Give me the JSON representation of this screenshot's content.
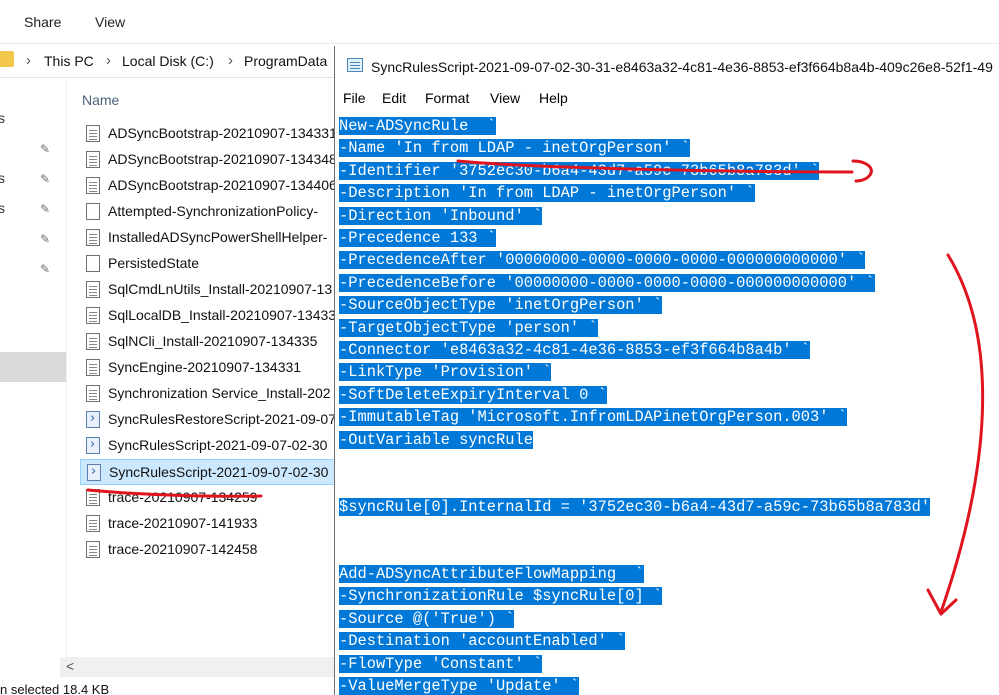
{
  "explorer": {
    "ribbon_tabs": [
      "Share",
      "View"
    ],
    "breadcrumb": [
      "This PC",
      "Local Disk (C:)",
      "ProgramData"
    ],
    "column_header": "Name",
    "nav_fragments": [
      "s",
      "s",
      "s"
    ],
    "files": [
      {
        "name": "ADSyncBootstrap-20210907-134331",
        "type": "text"
      },
      {
        "name": "ADSyncBootstrap-20210907-134348",
        "type": "text"
      },
      {
        "name": "ADSyncBootstrap-20210907-134406",
        "type": "text"
      },
      {
        "name": "Attempted-SynchronizationPolicy-",
        "type": "plain"
      },
      {
        "name": "InstalledADSyncPowerShellHelper-",
        "type": "text"
      },
      {
        "name": "PersistedState",
        "type": "plain"
      },
      {
        "name": "SqlCmdLnUtils_Install-20210907-13",
        "type": "text"
      },
      {
        "name": "SqlLocalDB_Install-20210907-13433",
        "type": "text"
      },
      {
        "name": "SqlNCli_Install-20210907-134335",
        "type": "text"
      },
      {
        "name": "SyncEngine-20210907-134331",
        "type": "text"
      },
      {
        "name": "Synchronization Service_Install-202",
        "type": "text"
      },
      {
        "name": "SyncRulesRestoreScript-2021-09-07",
        "type": "ps"
      },
      {
        "name": "SyncRulesScript-2021-09-07-02-30",
        "type": "ps"
      },
      {
        "name": "SyncRulesScript-2021-09-07-02-30",
        "type": "ps",
        "selected": true
      },
      {
        "name": "trace-20210907-134259",
        "type": "text"
      },
      {
        "name": "trace-20210907-141933",
        "type": "text"
      },
      {
        "name": "trace-20210907-142458",
        "type": "text"
      }
    ],
    "status": "n selected  18.4 KB"
  },
  "notepad": {
    "title": "SyncRulesScript-2021-09-07-02-30-31-e8463a32-4c81-4e36-8853-ef3f664b8a4b-409c26e8-52f1-49",
    "menu": [
      "File",
      "Edit",
      "Format",
      "View",
      "Help"
    ],
    "lines": [
      "New-ADSyncRule  `",
      "-Name 'In from LDAP - inetOrgPerson' `",
      "-Identifier '3752ec30-b6a4-43d7-a59c-73b65b8a783d' `",
      "-Description 'In from LDAP - inetOrgPerson' `",
      "-Direction 'Inbound' `",
      "-Precedence 133 `",
      "-PrecedenceAfter '00000000-0000-0000-0000-000000000000' `",
      "-PrecedenceBefore '00000000-0000-0000-0000-000000000000' `",
      "-SourceObjectType 'inetOrgPerson' `",
      "-TargetObjectType 'person' `",
      "-Connector 'e8463a32-4c81-4e36-8853-ef3f664b8a4b' `",
      "-LinkType 'Provision' `",
      "-SoftDeleteExpiryInterval 0 `",
      "-ImmutableTag 'Microsoft.InfromLDAPinetOrgPerson.003' `",
      "-OutVariable syncRule",
      "",
      "",
      "$syncRule[0].InternalId = '3752ec30-b6a4-43d7-a59c-73b65b8a783d'",
      "",
      "",
      "Add-ADSyncAttributeFlowMapping  `",
      "-SynchronizationRule $syncRule[0] `",
      "-Source @('True') `",
      "-Destination 'accountEnabled' `",
      "-FlowType 'Constant' `",
      "-ValueMergeType 'Update' `"
    ]
  },
  "colors": {
    "selection": "#0078d7",
    "annotation": "#e0141e",
    "explorer_selected_row": "#cce8ff"
  }
}
